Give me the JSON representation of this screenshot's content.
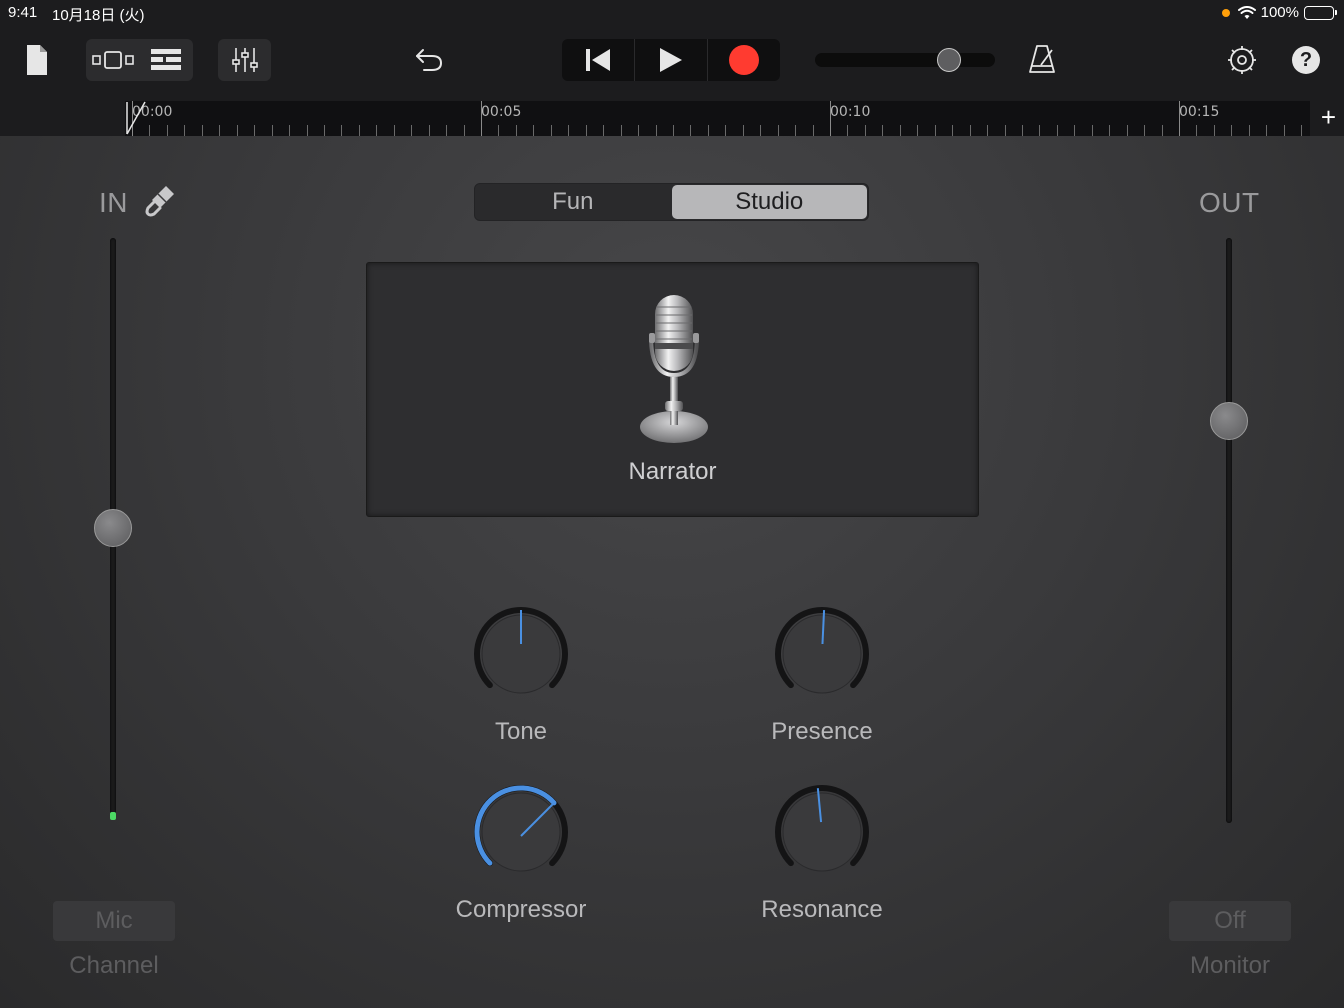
{
  "status_bar": {
    "time": "9:41",
    "date": "10月18日 (火)",
    "battery": "100%"
  },
  "toolbar": {
    "icons": [
      "document-icon",
      "view-toggle-icon",
      "tracks-view-icon",
      "mixer-icon",
      "undo-icon",
      "rewind-icon",
      "play-icon",
      "record-icon",
      "metronome-icon",
      "settings-icon",
      "help-icon"
    ],
    "help_label": "?",
    "volume_level": 0.78,
    "record_color": "#ff3b30"
  },
  "timeline": {
    "markers": [
      "00:00",
      "00:05",
      "00:10",
      "00:15"
    ],
    "add_label": "+"
  },
  "input": {
    "label": "IN",
    "level": 0.5,
    "channel_button": "Mic",
    "channel_label": "Channel"
  },
  "output": {
    "label": "OUT",
    "level": 0.7,
    "monitor_button": "Off",
    "monitor_label": "Monitor"
  },
  "mode_switch": {
    "options": [
      "Fun",
      "Studio"
    ],
    "selected": "Studio"
  },
  "preset": {
    "name": "Narrator",
    "icon": "microphone-icon"
  },
  "knobs": [
    {
      "label": "Tone",
      "value": 0.5
    },
    {
      "label": "Presence",
      "value": 0.51
    },
    {
      "label": "Compressor",
      "value": 0.68
    },
    {
      "label": "Resonance",
      "value": 0.48
    }
  ],
  "accent_color": "#4a90e2"
}
